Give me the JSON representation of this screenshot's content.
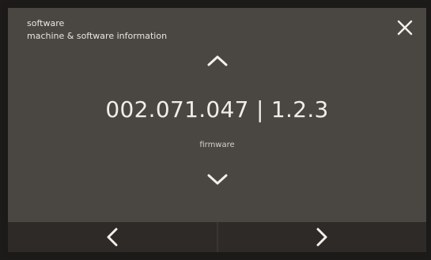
{
  "header": {
    "title": "software",
    "subtitle": "machine & software information"
  },
  "main": {
    "value": "002.071.047 | 1.2.3",
    "label": "firmware"
  },
  "icons": {
    "close": "close-icon",
    "up": "chevron-up-icon",
    "down": "chevron-down-icon",
    "prev": "chevron-left-icon",
    "next": "chevron-right-icon"
  },
  "colors": {
    "screen_bg": "#4a4642",
    "bottom_bg": "#2d2a27",
    "text": "#f1eee9"
  }
}
